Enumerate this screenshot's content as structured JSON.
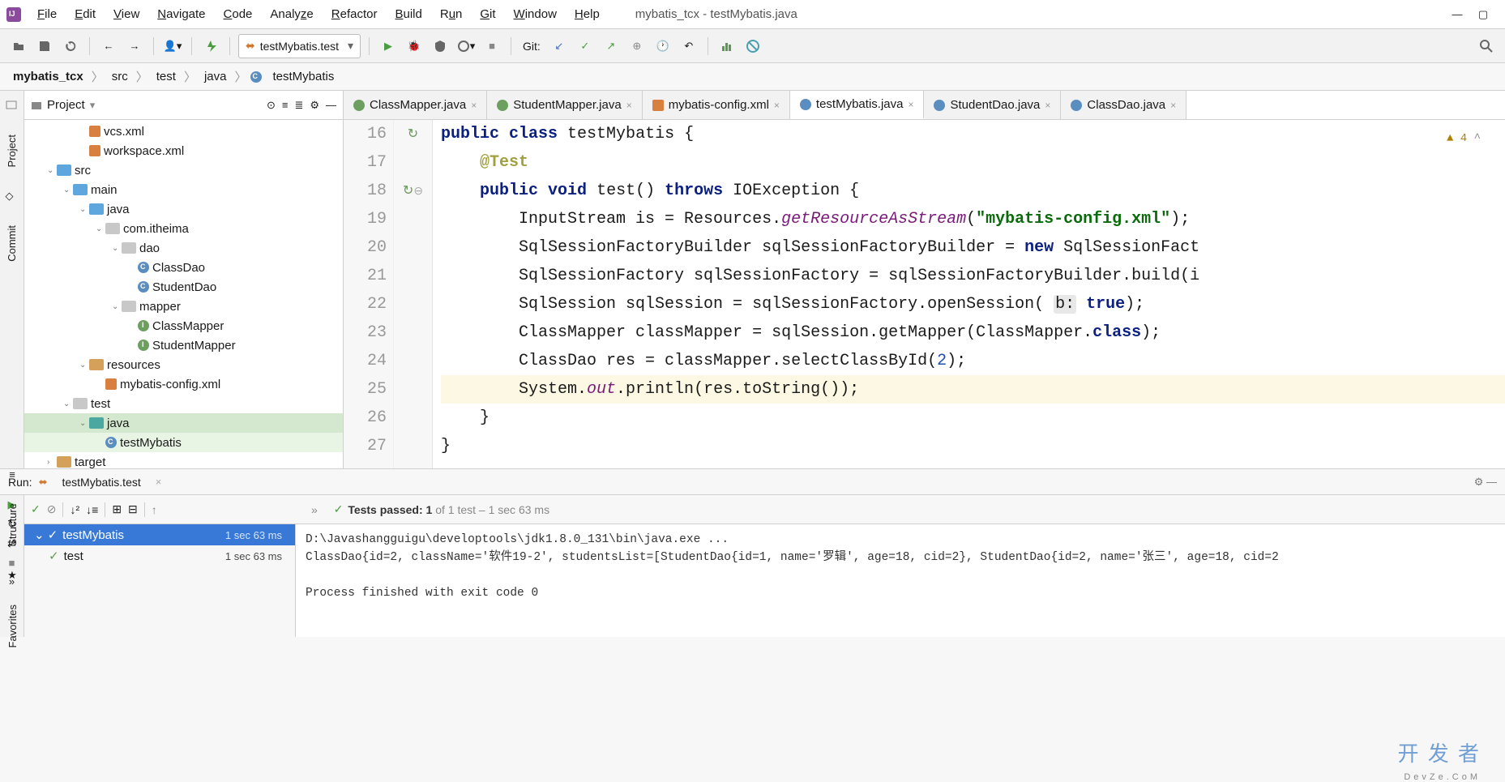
{
  "menubar": {
    "items": [
      "File",
      "Edit",
      "View",
      "Navigate",
      "Code",
      "Analyze",
      "Refactor",
      "Build",
      "Run",
      "Git",
      "Window",
      "Help"
    ],
    "title": "mybatis_tcx - testMybatis.java"
  },
  "toolbar": {
    "run_config": "testMybatis.test",
    "git_label": "Git:"
  },
  "breadcrumb": [
    "mybatis_tcx",
    "src",
    "test",
    "java",
    "testMybatis"
  ],
  "project_panel": {
    "title": "Project",
    "tree": [
      {
        "indent": 3,
        "icon": "file-orange",
        "label": "vcs.xml"
      },
      {
        "indent": 3,
        "icon": "file-orange",
        "label": "workspace.xml"
      },
      {
        "indent": 1,
        "chev": "v",
        "icon": "folder-blue",
        "label": "src"
      },
      {
        "indent": 2,
        "chev": "v",
        "icon": "folder-blue",
        "label": "main"
      },
      {
        "indent": 3,
        "chev": "v",
        "icon": "folder-blue",
        "label": "java"
      },
      {
        "indent": 4,
        "chev": "v",
        "icon": "folder-gray",
        "label": "com.itheima"
      },
      {
        "indent": 5,
        "chev": "v",
        "icon": "folder-gray",
        "label": "dao"
      },
      {
        "indent": 6,
        "icon": "file-class",
        "label": "ClassDao"
      },
      {
        "indent": 6,
        "icon": "file-class",
        "label": "StudentDao"
      },
      {
        "indent": 5,
        "chev": "v",
        "icon": "folder-gray",
        "label": "mapper"
      },
      {
        "indent": 6,
        "icon": "file-int",
        "label": "ClassMapper"
      },
      {
        "indent": 6,
        "icon": "file-int",
        "label": "StudentMapper"
      },
      {
        "indent": 3,
        "chev": "v",
        "icon": "folder-res",
        "label": "resources"
      },
      {
        "indent": 4,
        "icon": "file-orange",
        "label": "mybatis-config.xml"
      },
      {
        "indent": 2,
        "chev": "v",
        "icon": "folder-gray",
        "label": "test"
      },
      {
        "indent": 3,
        "chev": "v",
        "icon": "folder-teal",
        "label": "java",
        "selected": true
      },
      {
        "indent": 4,
        "icon": "file-class",
        "label": "testMybatis",
        "file_sel": true
      },
      {
        "indent": 1,
        "chev": ">",
        "icon": "folder-res",
        "label": "target"
      }
    ]
  },
  "sidebar_tabs": {
    "project": "Project",
    "commit": "Commit",
    "structure": "Structure",
    "favorites": "Favorites"
  },
  "editor_tabs": [
    {
      "icon": "file-int",
      "label": "ClassMapper.java"
    },
    {
      "icon": "file-int",
      "label": "StudentMapper.java"
    },
    {
      "icon": "file-orange",
      "label": "mybatis-config.xml"
    },
    {
      "icon": "file-class",
      "label": "testMybatis.java",
      "active": true
    },
    {
      "icon": "file-class",
      "label": "StudentDao.java"
    },
    {
      "icon": "file-class",
      "label": "ClassDao.java"
    }
  ],
  "editor": {
    "warning_count": "4",
    "lines": [
      {
        "n": 16,
        "gi": "↻",
        "html": "<span class='kw'>public</span> <span class='kw'>class</span> testMybatis {"
      },
      {
        "n": 17,
        "html": "    <span class='ann'>@Test</span>"
      },
      {
        "n": 18,
        "gi": "↻",
        "fold": "⊖",
        "html": "    <span class='kw'>public</span> <span class='kw'>void</span> test() <span class='kw'>throws</span> IOException {"
      },
      {
        "n": 19,
        "html": "        InputStream is = Resources.<span class='fld'>getResourceAsStream</span>(<span class='str'>\"mybatis-config.xml\"</span>);"
      },
      {
        "n": 20,
        "html": "        SqlSessionFactoryBuilder sqlSessionFactoryBuilder = <span class='kw'>new</span> SqlSessionFact"
      },
      {
        "n": 21,
        "html": "        SqlSessionFactory sqlSessionFactory = sqlSessionFactoryBuilder.build(i"
      },
      {
        "n": 22,
        "html": "        SqlSession sqlSession = sqlSessionFactory.openSession( <span class='param'>b:</span> <span class='kw'>true</span>);"
      },
      {
        "n": 23,
        "html": "        ClassMapper classMapper = sqlSession.getMapper(ClassMapper.<span class='kw'>class</span>);"
      },
      {
        "n": 24,
        "html": "        ClassDao res = classMapper.selectClassById(<span class='num'>2</span>);"
      },
      {
        "n": 25,
        "hl": true,
        "html": "        System.<span class='fld'>out</span>.println(res.toString());"
      },
      {
        "n": 26,
        "html": "    }"
      },
      {
        "n": 27,
        "html": "}"
      }
    ]
  },
  "run": {
    "title": "Run:",
    "tab": "testMybatis.test",
    "status_prefix": "Tests passed: 1",
    "status_suffix": " of 1 test – 1 sec 63 ms",
    "tests": [
      {
        "name": "testMybatis",
        "time": "1 sec 63 ms",
        "sel": true,
        "chev": "v"
      },
      {
        "name": "test",
        "time": "1 sec 63 ms",
        "sel": false
      }
    ],
    "console": [
      "D:\\Javashangguigu\\developtools\\jdk1.8.0_131\\bin\\java.exe ...",
      "ClassDao{id=2, className='软件19-2', studentsList=[StudentDao{id=1, name='罗辑', age=18, cid=2}, StudentDao{id=2, name='张三', age=18, cid=2",
      "",
      "Process finished with exit code 0"
    ]
  },
  "watermark": {
    "main": "开 发 者",
    "sub": "DevZe.CoM"
  }
}
